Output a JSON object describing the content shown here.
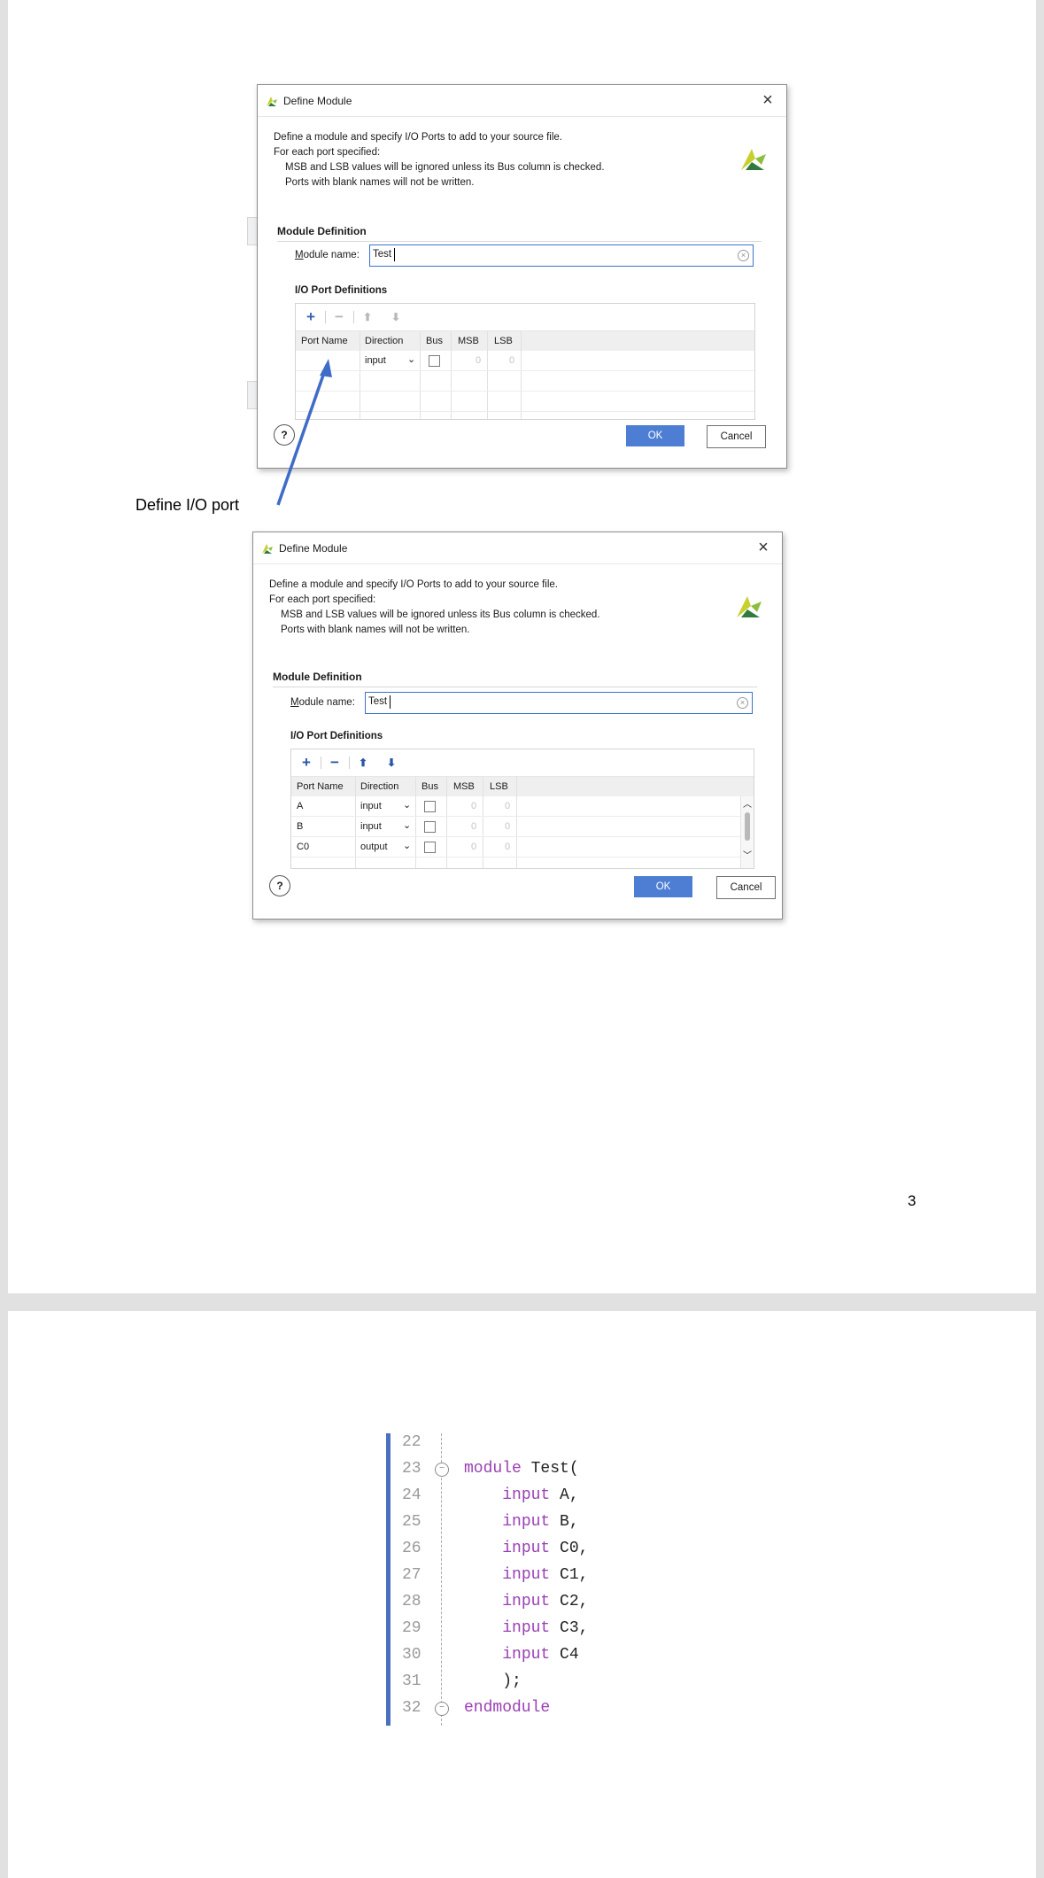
{
  "dialogs": [
    {
      "title": "Define Module",
      "description": [
        "Define a module and specify I/O Ports to add to your source file.",
        "For each port specified:",
        "MSB and LSB values will be ignored unless its Bus column is checked.",
        "Ports with blank names will not be written."
      ],
      "section_title": "Module Definition",
      "module_label_prefix": "M",
      "module_label_rest": "odule name:",
      "module_name": "Test",
      "io_title": "I/O Port Definitions",
      "columns": [
        "Port Name",
        "Direction",
        "Bus",
        "MSB",
        "LSB"
      ],
      "rows": [
        {
          "name": "",
          "direction": "input",
          "msb": "0",
          "lsb": "0"
        }
      ],
      "ok": "OK",
      "cancel": "Cancel",
      "help": "?"
    },
    {
      "title": "Define Module",
      "description": [
        "Define a module and specify I/O Ports to add to your source file.",
        "For each port specified:",
        "MSB and LSB values will be ignored unless its Bus column is checked.",
        "Ports with blank names will not be written."
      ],
      "section_title": "Module Definition",
      "module_label_prefix": "M",
      "module_label_rest": "odule name:",
      "module_name": "Test",
      "io_title": "I/O Port Definitions",
      "columns": [
        "Port Name",
        "Direction",
        "Bus",
        "MSB",
        "LSB"
      ],
      "rows": [
        {
          "name": "A",
          "direction": "input",
          "msb": "0",
          "lsb": "0"
        },
        {
          "name": "B",
          "direction": "input",
          "msb": "0",
          "lsb": "0"
        },
        {
          "name": "C0",
          "direction": "output",
          "msb": "0",
          "lsb": "0"
        }
      ],
      "ok": "OK",
      "cancel": "Cancel",
      "help": "?"
    }
  ],
  "toolbar_icons": [
    "plus-icon",
    "minus-icon",
    "arrow-up-icon",
    "arrow-down-icon"
  ],
  "annotation": "Define I/O port",
  "page_number": "3",
  "code_lines": [
    {
      "num": "22",
      "text": ""
    },
    {
      "num": "23",
      "text": "module Test("
    },
    {
      "num": "24",
      "text": "    input A,"
    },
    {
      "num": "25",
      "text": "    input B,"
    },
    {
      "num": "26",
      "text": "    input C0,"
    },
    {
      "num": "27",
      "text": "    input C1,"
    },
    {
      "num": "28",
      "text": "    input C2,"
    },
    {
      "num": "29",
      "text": "    input C3,"
    },
    {
      "num": "30",
      "text": "    input C4"
    },
    {
      "num": "31",
      "text": "    );"
    },
    {
      "num": "32",
      "text": "endmodule"
    }
  ],
  "colors": {
    "accent": "#4d7ed4",
    "code_bar": "#4a70c0",
    "keyword": "#9a3fb4"
  }
}
